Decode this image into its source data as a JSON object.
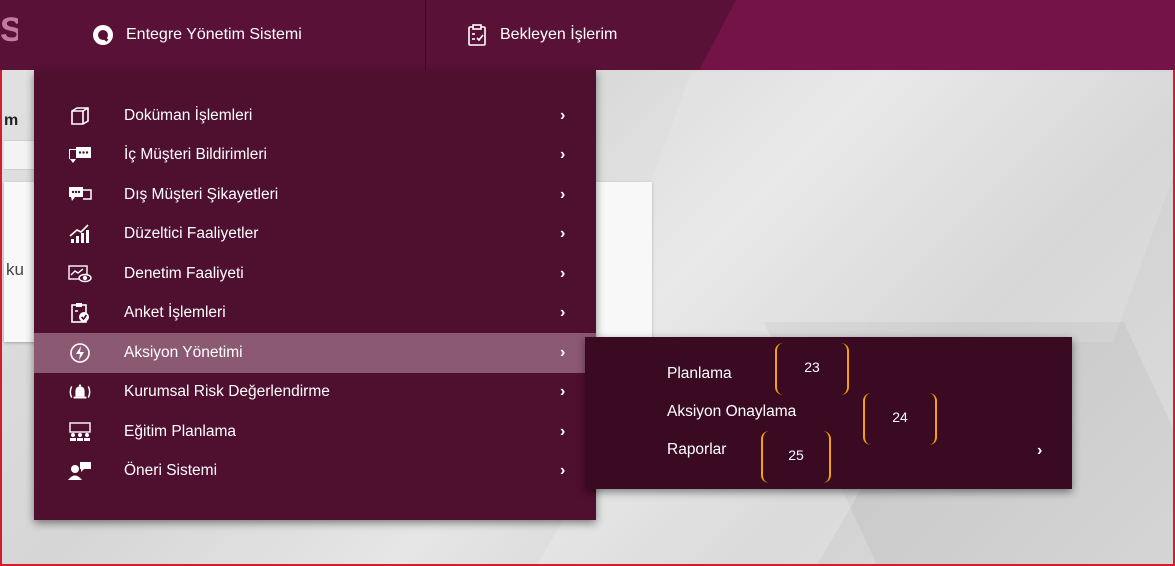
{
  "topbar": {
    "brand_fragment": "S",
    "tabs": [
      {
        "label": "Entegre Yönetim Sistemi",
        "icon": "q-logo-icon"
      },
      {
        "label": "Bekleyen İşlerim",
        "icon": "clipboard-list-icon"
      }
    ]
  },
  "background": {
    "label_fragment": "m",
    "card_text_fragment": "ku"
  },
  "menu": {
    "items": [
      {
        "label": "Doküman İşlemleri",
        "icon": "box-icon",
        "arrow": "›"
      },
      {
        "label": "İç Müşteri Bildirimleri",
        "icon": "chat-bubble-icon",
        "arrow": "›"
      },
      {
        "label": "Dış Müşteri Şikayetleri",
        "icon": "chat-bubbles-icon",
        "arrow": "›"
      },
      {
        "label": "Düzeltici Faaliyetler",
        "icon": "bar-chart-growth-icon",
        "arrow": "›"
      },
      {
        "label": "Denetim Faaliyeti",
        "icon": "inspection-eye-icon",
        "arrow": "›"
      },
      {
        "label": "Anket İşlemleri",
        "icon": "clipboard-check-icon",
        "arrow": "›"
      },
      {
        "label": "Aksiyon Yönetimi",
        "icon": "lightning-circle-icon",
        "arrow": "›",
        "active": true
      },
      {
        "label": "Kurumsal Risk Değerlendirme",
        "icon": "alarm-bell-icon",
        "arrow": "›"
      },
      {
        "label": "Eğitim Planlama",
        "icon": "training-group-icon",
        "arrow": "›"
      },
      {
        "label": "Öneri Sistemi",
        "icon": "user-suggestion-icon",
        "arrow": "›"
      }
    ]
  },
  "submenu": {
    "items": [
      {
        "label": "Planlama"
      },
      {
        "label": "Aksiyon Onaylama"
      },
      {
        "label": "Raporlar",
        "arrow": "›"
      }
    ]
  },
  "callouts": [
    "23",
    "24",
    "25"
  ],
  "colors": {
    "topbar": "#731347",
    "menu_bg": "#4f0f2e",
    "menu_active": "#8c5972",
    "submenu_bg": "#390a22",
    "callout": "#f5a300",
    "frame_border": "#d11e2a"
  }
}
